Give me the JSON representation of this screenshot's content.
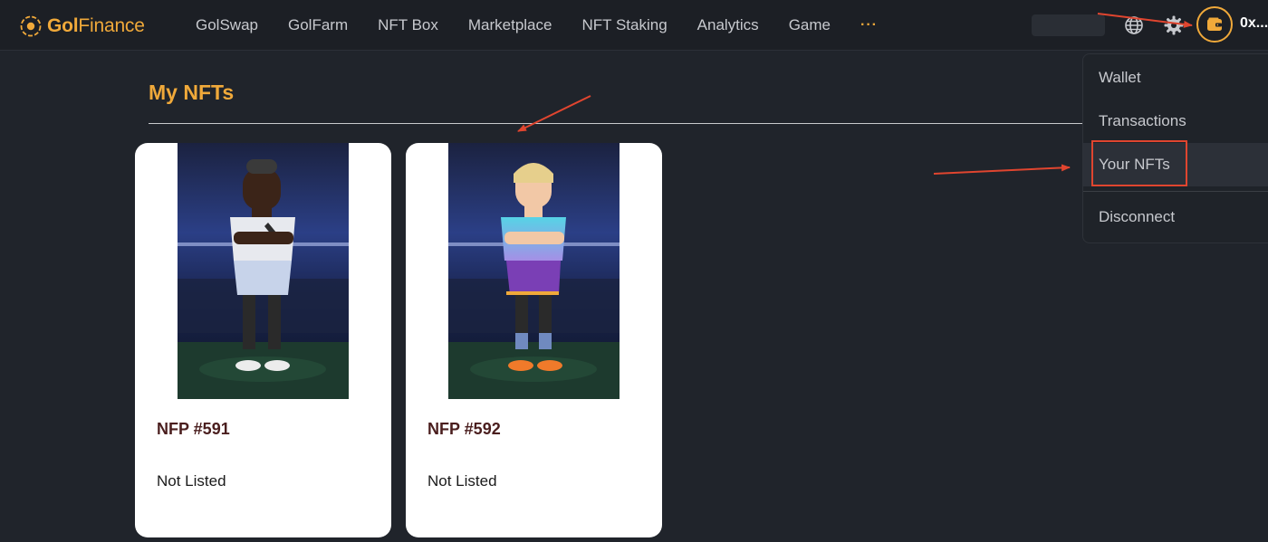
{
  "brand": {
    "bold": "Gol",
    "rest": "Finance"
  },
  "nav": {
    "items": [
      {
        "label": "GolSwap"
      },
      {
        "label": "GolFarm"
      },
      {
        "label": "NFT Box"
      },
      {
        "label": "Marketplace"
      },
      {
        "label": "NFT Staking"
      },
      {
        "label": "Analytics"
      },
      {
        "label": "Game"
      }
    ],
    "more": "···"
  },
  "header": {
    "address": "0x..."
  },
  "page": {
    "title": "My NFTs"
  },
  "cards": [
    {
      "name": "NFP #591",
      "status": "Not Listed"
    },
    {
      "name": "NFP #592",
      "status": "Not Listed"
    }
  ],
  "dropdown": {
    "items": [
      {
        "label": "Wallet"
      },
      {
        "label": "Transactions"
      },
      {
        "label": "Your NFTs"
      },
      {
        "label": "Disconnect"
      }
    ]
  },
  "colors": {
    "accent": "#f0a93a",
    "background": "#20242b",
    "annotation": "#e0452f"
  },
  "icons": [
    "soccer-ball-logo-icon",
    "globe-icon",
    "gear-icon",
    "wallet-icon",
    "more-icon"
  ]
}
